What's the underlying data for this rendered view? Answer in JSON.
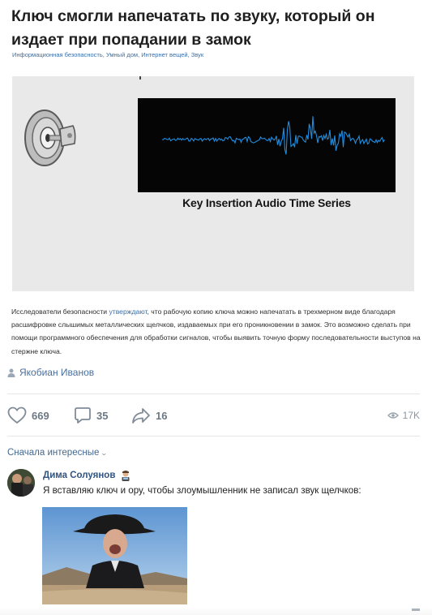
{
  "article": {
    "title": "Ключ смогли напечатать по звуку, который он издает при попадании в замок",
    "tags": [
      "Информационная безопасность,",
      "Умный дом,",
      "Интернет вещей,",
      "Звук"
    ],
    "image_caption": "Key Insertion Audio Time Series",
    "body_prefix": "Исследователи безопасности ",
    "body_link": "утверждают",
    "body_suffix": ", что рабочую копию ключа можно напечатать в трехмерном виде благодаря расшифровке слышимых металлических щелчков, издаваемых при его проникновении в замок. Это возможно сделать при помощи программного обеспечения для обработки сигналов, чтобы выявить точную форму последовательности выступов на стержне ключа.",
    "author": "Якобиан Иванов"
  },
  "actions": {
    "likes": "669",
    "comments": "35",
    "shares": "16",
    "views": "17K"
  },
  "comments_section": {
    "sort_label": "Сначала интересные",
    "comment": {
      "author": "Дима Солуянов",
      "text": "Я вставляю ключ и ору, чтобы злоумышленник не записал звук щелчков:"
    }
  },
  "icons": {
    "like": "heart-icon",
    "comment": "comment-icon",
    "share": "share-icon",
    "views": "eye-icon",
    "author": "person-icon",
    "sort": "chevron-down-icon"
  },
  "colors": {
    "link": "#3b6ea8",
    "author_link": "#4a6f9c",
    "comment_author": "#2f5484",
    "action_gray": "#6d7885",
    "waveform": "#1f8de0"
  }
}
